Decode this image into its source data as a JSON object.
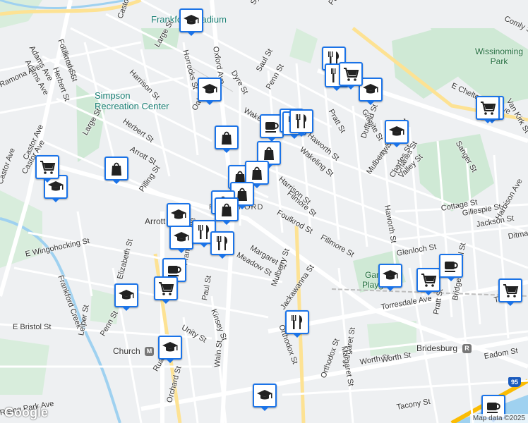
{
  "map": {
    "pois": {
      "stadium": "Frankford Stadium",
      "recreation": "Simpson Recreation Center",
      "park": "Wissinoming Park",
      "playground": "Gam Playgr"
    },
    "neighborhood": "FRANKFORD",
    "transit": {
      "arrott": "Arrott",
      "church": "Church",
      "bridesburg": "Bridesburg",
      "interstate": "95"
    },
    "streets": [
      "Castor Ave",
      "Fillmore St",
      "Foulkrod St",
      "Herbert St",
      "Adams Ave",
      "Ramona Ave",
      "Large St",
      "Horrocks St",
      "Harrison St",
      "Oxford Ave",
      "Dyre St",
      "Saul St",
      "Sylvester St",
      "Penn St",
      "Wakeling St",
      "Oak",
      "Herbert St",
      "Arrott St",
      "Large St",
      "Castor Ave",
      "Pilling St",
      "E Wingohocking St",
      "Elizabeth St",
      "Frankford Creek",
      "Frankford Ave",
      "Paul St",
      "Kinsey St",
      "Unity St",
      "E Bristol St",
      "Leiper St",
      "Penn St",
      "Ruan St",
      "Waln St",
      "Orchard St",
      "Margaret St",
      "Meadow St",
      "Mulberry St",
      "Orthodox St",
      "Haworth St",
      "Wakeling St",
      "Harrison St",
      "Filmore St",
      "Foulkrod St",
      "Fillmore St",
      "Pratt St",
      "Granite St",
      "Duffield St",
      "Hawthorne St",
      "Mulberry St",
      "Charles St",
      "Valley St",
      "Haworth St",
      "Cottage St",
      "Gillespie St",
      "Jackson St",
      "Glenloch St",
      "Brill St",
      "Harbison Ave",
      "Torresdale Ave",
      "Pratt St",
      "Margaret St",
      "Orthodox St",
      "Worth St",
      "Eadom St",
      "Tacony St",
      "E Cheltenham Ave",
      "Comly St",
      "Sanger St",
      "Van Kirk St",
      "Castor Ave",
      "Adams Ave",
      "Adams Ave",
      "Jackawanna St",
      "Bridge St",
      "Tulip St",
      "Penn St",
      "Worth St",
      "Margaret St",
      "Ditman St",
      "Charles St",
      "Rising Park Ave",
      "Castor Ave"
    ],
    "markers": [
      {
        "type": "school"
      },
      {
        "type": "school"
      },
      {
        "type": "cafe"
      },
      {
        "type": "restaurant"
      },
      {
        "type": "restaurant"
      },
      {
        "type": "school"
      },
      {
        "type": "school"
      },
      {
        "type": "restaurant"
      },
      {
        "type": "restaurant"
      },
      {
        "type": "shop"
      },
      {
        "type": "shop"
      },
      {
        "type": "shop"
      },
      {
        "type": "school"
      },
      {
        "type": "grocery"
      },
      {
        "type": "school"
      },
      {
        "type": "shop"
      },
      {
        "type": "shop"
      },
      {
        "type": "shop"
      },
      {
        "type": "shop"
      },
      {
        "type": "shop"
      },
      {
        "type": "school"
      },
      {
        "type": "school"
      },
      {
        "type": "restaurant"
      },
      {
        "type": "restaurant"
      },
      {
        "type": "restaurant"
      },
      {
        "type": "cafe"
      },
      {
        "type": "grocery"
      },
      {
        "type": "grocery"
      },
      {
        "type": "school"
      },
      {
        "type": "restaurant"
      },
      {
        "type": "school"
      },
      {
        "type": "grocery"
      },
      {
        "type": "cafe"
      },
      {
        "type": "grocery"
      },
      {
        "type": "school"
      },
      {
        "type": "school"
      },
      {
        "type": "cafe"
      },
      {
        "type": "grocery"
      }
    ],
    "attribution": "Map data ©2025",
    "logo": "Google"
  }
}
